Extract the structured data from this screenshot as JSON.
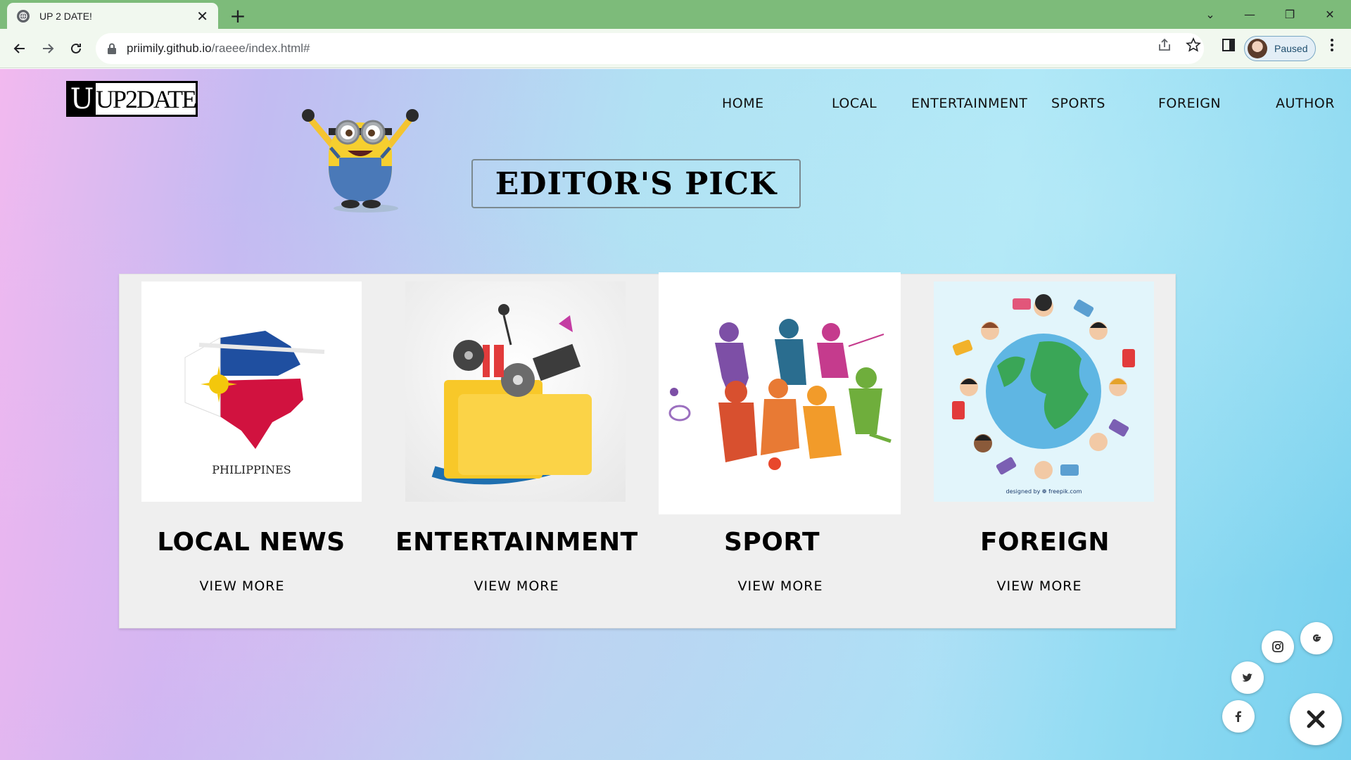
{
  "browser": {
    "tab_title": "UP 2 DATE!",
    "tab_close": "✕",
    "new_tab": "+",
    "url_host": "priimily.github.io",
    "url_path": "/raeee/index.html#",
    "profile_status": "Paused",
    "window_controls": [
      "⌄",
      "—",
      "❐",
      "✕"
    ]
  },
  "logo": {
    "letter": "U",
    "text": "UP2DATE"
  },
  "nav": {
    "items": [
      "HOME",
      "LOCAL",
      "ENTERTAINMENT",
      "SPORTS",
      "FOREIGN",
      "AUTHOR"
    ]
  },
  "hero": {
    "title": "EDITOR'S PICK"
  },
  "cards": [
    {
      "title": "LOCAL NEWS",
      "image_caption": "PHILIPPINES",
      "link": "VIEW MORE"
    },
    {
      "title": "ENTERTAINMENT",
      "link": "VIEW MORE"
    },
    {
      "title": "SPORT",
      "link": "VIEW MORE"
    },
    {
      "title": "FOREIGN",
      "image_caption": "designed by ❁ freepik.com",
      "link": "VIEW MORE"
    }
  ],
  "social": {
    "icons": [
      "instagram-icon",
      "google-icon",
      "twitter-icon",
      "facebook-icon",
      "close-icon"
    ]
  },
  "colors": {
    "tab_bar": "#7dbb7a",
    "toolbar": "#f1f8ef",
    "card_panel": "#efefef",
    "flag_blue": "#1f4fa0",
    "flag_red": "#d1123f",
    "flag_yellow": "#f3c70c"
  }
}
